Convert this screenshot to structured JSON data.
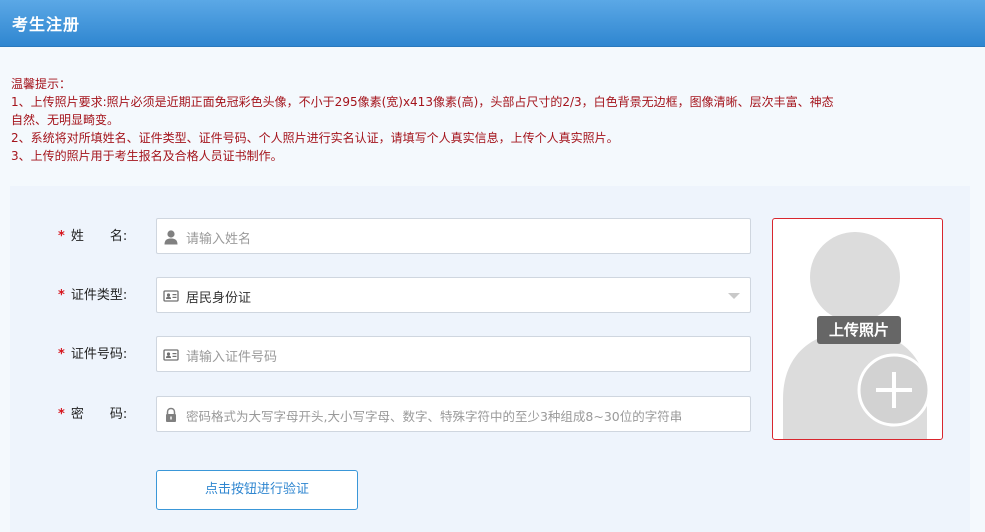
{
  "header": {
    "title": "考生注册"
  },
  "notice": {
    "title": "温馨提示：",
    "lines": [
      "1、上传照片要求:照片必须是近期正面免冠彩色头像，不小于295像素(宽)x413像素(高)，头部占尺寸的2/3，白色背景无边框，图像清晰、层次丰富、神态",
      "自然、无明显畸变。",
      "2、系统将对所填姓名、证件类型、证件号码、个人照片进行实名认证，请填写个人真实信息，上传个人真实照片。",
      "3、上传的照片用于考生报名及合格人员证书制作。"
    ]
  },
  "form": {
    "required_mark": "*",
    "name": {
      "label": "姓　　名:",
      "placeholder": "请输入姓名"
    },
    "id_type": {
      "label": "证件类型:",
      "value": "居民身份证"
    },
    "id_number": {
      "label": "证件号码:",
      "placeholder": "请输入证件号码"
    },
    "password": {
      "label": "密　　码:",
      "placeholder": "密码格式为大写字母开头,大小写字母、数字、特殊字符中的至少3种组成8~30位的字符串"
    },
    "verify_button": "点击按钮进行验证"
  },
  "photo": {
    "upload_label": "上传照片"
  },
  "icons": {
    "name_field": "user-icon",
    "id_type_field": "id-card-icon",
    "id_number_field": "id-card-icon",
    "password_field": "lock-icon",
    "photo_placeholder": "avatar-icon",
    "photo_add": "plus-icon",
    "select_caret": "chevron-down-icon"
  },
  "colors": {
    "header_blue": "#2f86d0",
    "notice_red": "#a4141c",
    "required_red": "#d6141c",
    "button_blue": "#3a97d8"
  }
}
